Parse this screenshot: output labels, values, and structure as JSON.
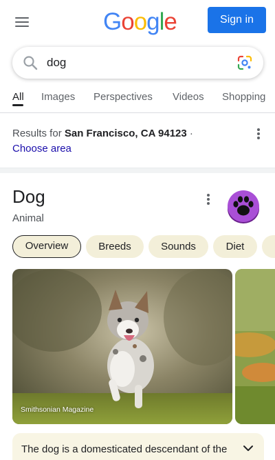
{
  "header": {
    "menu_icon": "hamburger-menu-icon",
    "logo_letters": [
      {
        "char": "G",
        "color": "#4285F4"
      },
      {
        "char": "o",
        "color": "#EA4335"
      },
      {
        "char": "o",
        "color": "#FBBC05"
      },
      {
        "char": "g",
        "color": "#4285F4"
      },
      {
        "char": "l",
        "color": "#34A853"
      },
      {
        "char": "e",
        "color": "#EA4335"
      }
    ],
    "sign_in_label": "Sign in",
    "sign_in_color": "#1a73e8"
  },
  "search": {
    "query": "dog",
    "search_icon": "search-icon",
    "lens_icon": "google-lens-icon"
  },
  "tabs": [
    {
      "label": "All",
      "active": true
    },
    {
      "label": "Images",
      "active": false
    },
    {
      "label": "Perspectives",
      "active": false
    },
    {
      "label": "Videos",
      "active": false
    },
    {
      "label": "Shopping",
      "active": false
    }
  ],
  "location": {
    "prefix": "Results for ",
    "place": "San Francisco, CA 94123",
    "suffix": " ·",
    "choose_area": "Choose area"
  },
  "knowledge_panel": {
    "title": "Dog",
    "subtitle": "Animal",
    "avatar_icon": "paw-print-icon",
    "avatar_color": "#9b3fc6",
    "chips": [
      {
        "label": "Overview",
        "active": true
      },
      {
        "label": "Breeds",
        "active": false
      },
      {
        "label": "Sounds",
        "active": false
      },
      {
        "label": "Diet",
        "active": false
      }
    ],
    "image_credit": "Smithsonian Magazine",
    "description": "The dog is a domesticated descendant of the wolf. Also called the domestic dog, it is"
  }
}
